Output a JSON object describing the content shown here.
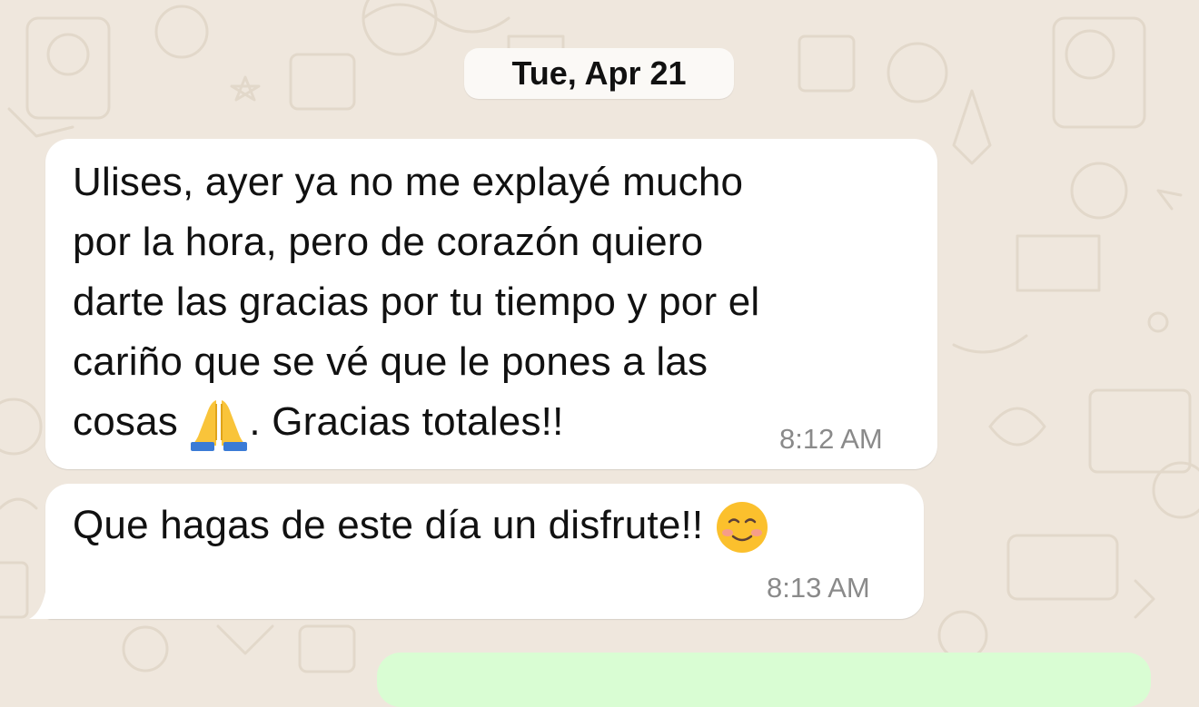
{
  "chat": {
    "date_separator": "Tue, Apr 21",
    "messages": [
      {
        "lines": [
          "Ulises, ayer ya no me explayé mucho",
          "por la hora, pero de corazón quiero",
          "darte las gracias por tu tiempo y por el",
          "cariño que se vé que le pones a las"
        ],
        "last_line_before_emoji": "cosas ",
        "emoji": "folded-hands-emoji",
        "last_line_after_emoji": ". Gracias totales!!",
        "time": "8:12 AM"
      },
      {
        "text": "Que hagas de este día un disfrute!! ",
        "emoji": "smiling-face-emoji",
        "time": "8:13 AM"
      }
    ]
  },
  "colors": {
    "wallpaper": "#efe7dd",
    "incoming_bubble": "#ffffff",
    "outgoing_bubble": "#d9fdd3",
    "timestamp": "#8a8a8a"
  }
}
